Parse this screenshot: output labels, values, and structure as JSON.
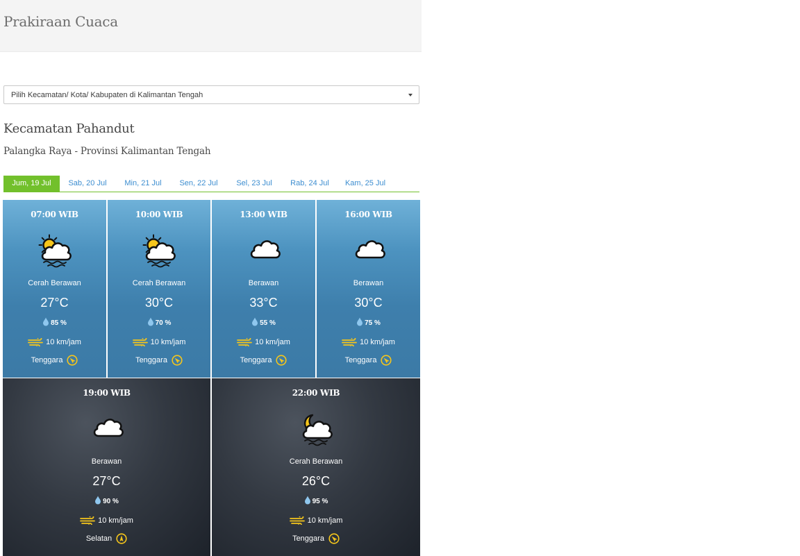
{
  "page": {
    "title": "Prakiraan Cuaca"
  },
  "location_select": {
    "placeholder": "Pilih Kecamatan/ Kota/ Kabupaten di Kalimantan Tengah"
  },
  "location": {
    "name": "Kecamatan Pahandut",
    "region": "Palangka Raya - Provinsi Kalimantan Tengah"
  },
  "tabs": [
    {
      "label": "Jum, 19 Jul",
      "active": true
    },
    {
      "label": "Sab, 20 Jul",
      "active": false
    },
    {
      "label": "Min, 21 Jul",
      "active": false
    },
    {
      "label": "Sen, 22 Jul",
      "active": false
    },
    {
      "label": "Sel, 23 Jul",
      "active": false
    },
    {
      "label": "Rab, 24 Jul",
      "active": false
    },
    {
      "label": "Kam, 25 Jul",
      "active": false
    }
  ],
  "forecasts": [
    {
      "time": "07:00 WIB",
      "icon": "sun-cloud-haze-icon",
      "condition": "Cerah Berawan",
      "temperature": "27°C",
      "humidity": "85 %",
      "wind_speed": "10 km/jam",
      "wind_direction": "Tenggara",
      "period": "day"
    },
    {
      "time": "10:00 WIB",
      "icon": "sun-cloud-haze-icon",
      "condition": "Cerah Berawan",
      "temperature": "30°C",
      "humidity": "70 %",
      "wind_speed": "10 km/jam",
      "wind_direction": "Tenggara",
      "period": "day"
    },
    {
      "time": "13:00 WIB",
      "icon": "cloud-icon",
      "condition": "Berawan",
      "temperature": "33°C",
      "humidity": "55 %",
      "wind_speed": "10 km/jam",
      "wind_direction": "Tenggara",
      "period": "day"
    },
    {
      "time": "16:00 WIB",
      "icon": "cloud-icon",
      "condition": "Berawan",
      "temperature": "30°C",
      "humidity": "75 %",
      "wind_speed": "10 km/jam",
      "wind_direction": "Tenggara",
      "period": "day"
    },
    {
      "time": "19:00 WIB",
      "icon": "cloud-icon",
      "condition": "Berawan",
      "temperature": "27°C",
      "humidity": "90 %",
      "wind_speed": "10 km/jam",
      "wind_direction": "Selatan",
      "period": "night"
    },
    {
      "time": "22:00 WIB",
      "icon": "moon-cloud-haze-icon",
      "condition": "Cerah Berawan",
      "temperature": "26°C",
      "humidity": "95 %",
      "wind_speed": "10 km/jam",
      "wind_direction": "Tenggara",
      "period": "night"
    }
  ],
  "colors": {
    "accent_green": "#72c02c",
    "tab_link": "#3c8dd0",
    "icon_yellow": "#f6c61b",
    "drop_blue": "#8fc7ee"
  }
}
